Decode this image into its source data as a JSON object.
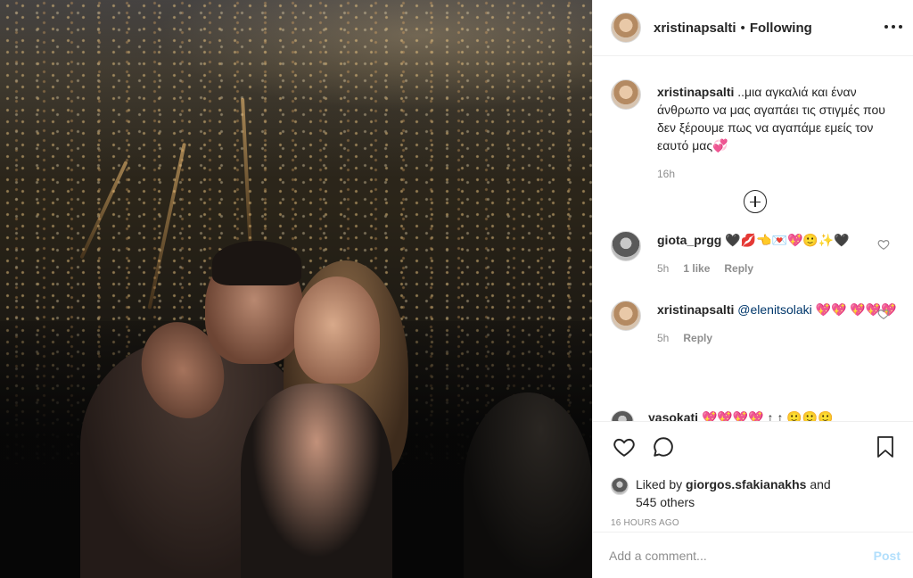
{
  "post": {
    "author": "xristinapsalti",
    "separator": "•",
    "follow_status": "Following"
  },
  "caption": {
    "username": "xristinapsalti",
    "text": "..μια αγκαλιά και έναν άνθρωπο να μας αγαπάει τις στιγμές που δεν ξέρουμε πως να αγαπάμε εμείς τον εαυτό μας💞",
    "time": "16h"
  },
  "comments": [
    {
      "username": "giota_prgg",
      "text": "🖤💋👈💌💖🙂✨🖤",
      "time": "5h",
      "likes": "1 like",
      "reply_label": "Reply"
    },
    {
      "username": "xristinapsalti",
      "mention": "@elenitsolaki",
      "text": "💖💖 💖💖💖",
      "time": "5h",
      "reply_label": "Reply"
    },
    {
      "username": "yasokati",
      "text": "💖💖💖💖 ↑ ↑ 🙂🙂🙂"
    }
  ],
  "likes": {
    "prefix": "Liked by",
    "user": "giorgos.sfakianakhs",
    "middle": "and",
    "others": "545 others"
  },
  "timestamp": "16 HOURS AGO",
  "add_comment": {
    "placeholder": "Add a comment...",
    "post_label": "Post"
  },
  "icons": {
    "more": "more-icon",
    "load_more": "plus-circle-icon",
    "like": "heart-icon",
    "comment": "comment-icon",
    "save": "bookmark-icon"
  },
  "colors": {
    "text": "#262626",
    "secondary": "#8e8e8e",
    "border": "#efefef",
    "post_disabled": "#b2dffc",
    "mention": "#00376b"
  }
}
